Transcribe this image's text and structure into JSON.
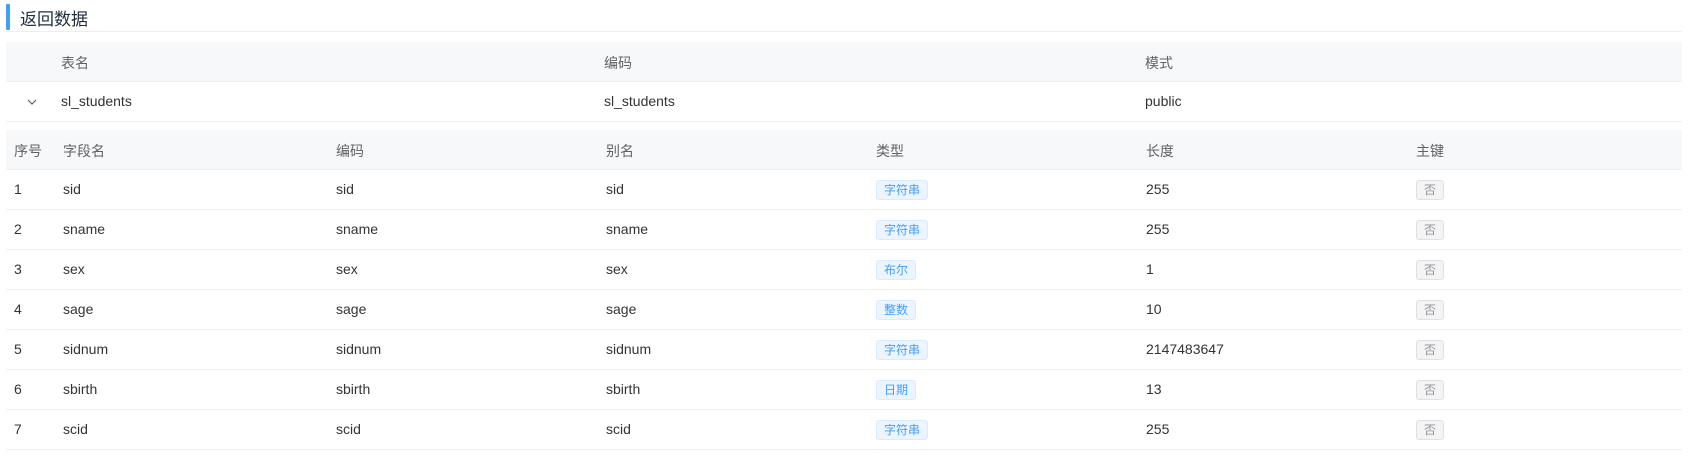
{
  "section": {
    "title": "返回数据"
  },
  "table_info": {
    "headers": {
      "table_name": "表名",
      "code": "编码",
      "schema": "模式"
    },
    "row": {
      "table_name": "sl_students",
      "code": "sl_students",
      "schema": "public"
    }
  },
  "fields": {
    "headers": {
      "index": "序号",
      "field_name": "字段名",
      "code": "编码",
      "alias": "别名",
      "type": "类型",
      "length": "长度",
      "primary_key": "主键"
    },
    "rows": [
      {
        "index": "1",
        "field_name": "sid",
        "code": "sid",
        "alias": "sid",
        "type": "字符串",
        "length": "255",
        "primary_key": "否"
      },
      {
        "index": "2",
        "field_name": "sname",
        "code": "sname",
        "alias": "sname",
        "type": "字符串",
        "length": "255",
        "primary_key": "否"
      },
      {
        "index": "3",
        "field_name": "sex",
        "code": "sex",
        "alias": "sex",
        "type": "布尔",
        "length": "1",
        "primary_key": "否"
      },
      {
        "index": "4",
        "field_name": "sage",
        "code": "sage",
        "alias": "sage",
        "type": "整数",
        "length": "10",
        "primary_key": "否"
      },
      {
        "index": "5",
        "field_name": "sidnum",
        "code": "sidnum",
        "alias": "sidnum",
        "type": "字符串",
        "length": "2147483647",
        "primary_key": "否"
      },
      {
        "index": "6",
        "field_name": "sbirth",
        "code": "sbirth",
        "alias": "sbirth",
        "type": "日期",
        "length": "13",
        "primary_key": "否"
      },
      {
        "index": "7",
        "field_name": "scid",
        "code": "scid",
        "alias": "scid",
        "type": "字符串",
        "length": "255",
        "primary_key": "否"
      }
    ]
  },
  "colors": {
    "accent": "#409eff",
    "header_bg": "#f7f8fa",
    "tag_blue": "#409eff",
    "tag_gray": "#909399"
  }
}
